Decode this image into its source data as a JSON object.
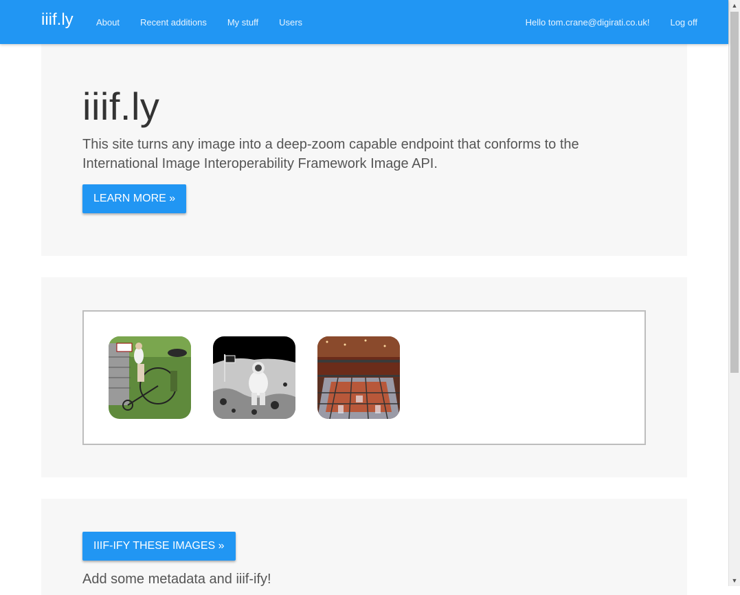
{
  "nav": {
    "brand": "iiif.ly",
    "links": [
      "About",
      "Recent additions",
      "My stuff",
      "Users"
    ],
    "greeting": "Hello tom.crane@digirati.co.uk!",
    "logoff": "Log off"
  },
  "jumbotron": {
    "title": "iiif.ly",
    "lead": "This site turns any image into a deep-zoom capable endpoint that conforms to the International Image Interoperability Framework Image API.",
    "button": "Learn more »"
  },
  "gallery": {
    "thumbnails": [
      {
        "name": "penny-farthing-thumbnail"
      },
      {
        "name": "astronaut-moon-thumbnail"
      },
      {
        "name": "building-interior-thumbnail"
      }
    ]
  },
  "actions": {
    "button": "IIIF-ify these images »",
    "subtext": "Add some metadata and iiif-ify!"
  },
  "colors": {
    "primary": "#2196f3",
    "panel": "#f7f7f7"
  }
}
